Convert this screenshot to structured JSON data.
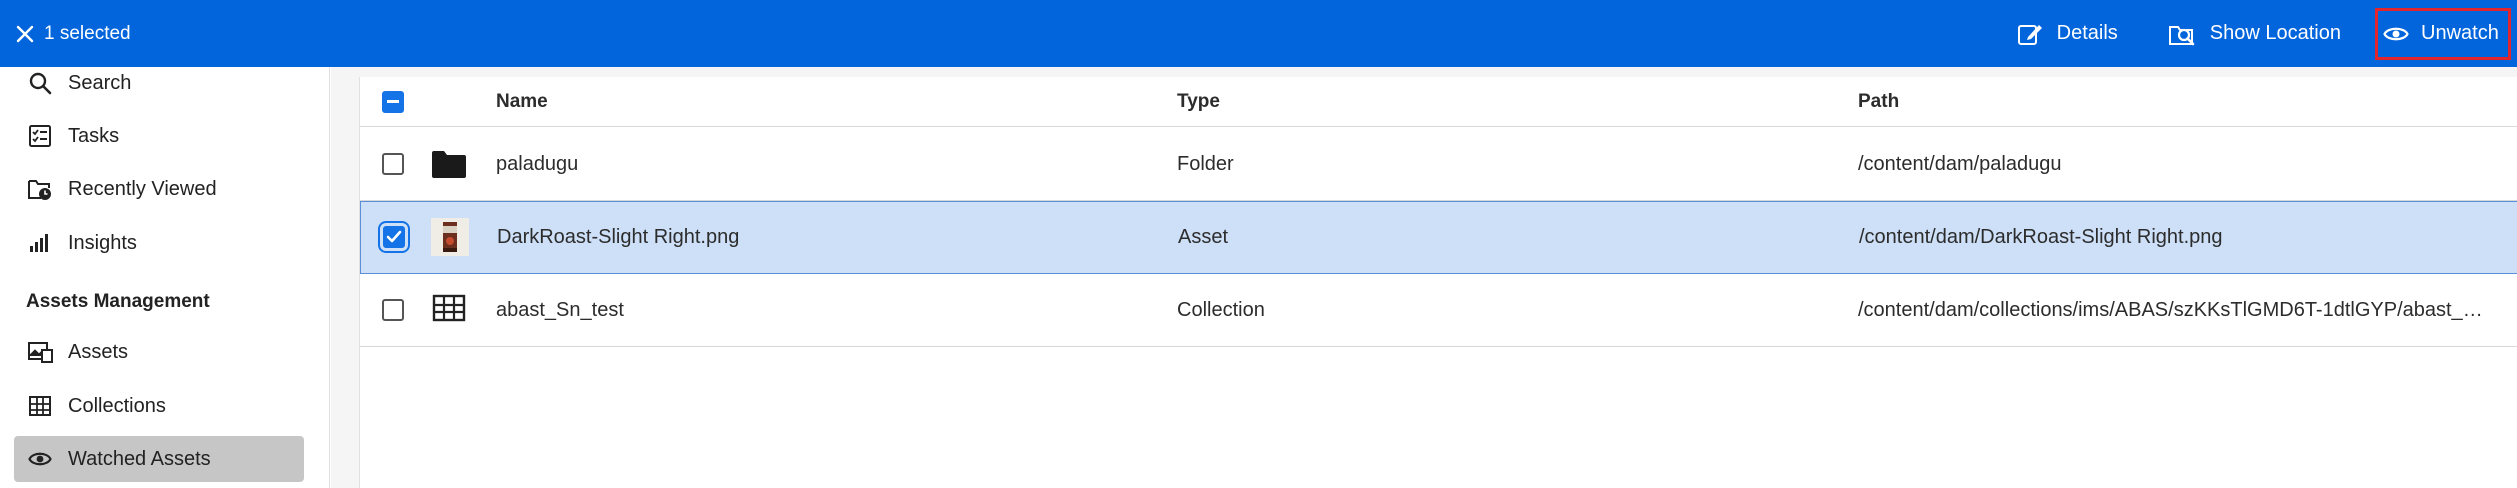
{
  "topbar": {
    "selected_label": "1 selected",
    "actions": {
      "details": "Details",
      "show_location": "Show Location",
      "unwatch": "Unwatch"
    },
    "background": "#0265dc"
  },
  "sidebar": {
    "items": [
      {
        "label": "Search",
        "icon": "search-icon"
      },
      {
        "label": "Tasks",
        "icon": "tasks-icon"
      },
      {
        "label": "Recently Viewed",
        "icon": "recently-viewed-icon"
      },
      {
        "label": "Insights",
        "icon": "insights-icon"
      }
    ],
    "section_title": "Assets Management",
    "section_items": [
      {
        "label": "Assets",
        "icon": "assets-icon"
      },
      {
        "label": "Collections",
        "icon": "collections-icon"
      },
      {
        "label": "Watched Assets",
        "icon": "eye-icon",
        "active": true
      }
    ]
  },
  "table": {
    "columns": {
      "name": "Name",
      "type": "Type",
      "path": "Path"
    },
    "rows": [
      {
        "name": "paladugu",
        "type": "Folder",
        "path": "/content/dam/paladugu",
        "icon": "folder-icon",
        "selected": false
      },
      {
        "name": "DarkRoast-Slight Right.png",
        "type": "Asset",
        "path": "/content/dam/DarkRoast-Slight Right.png",
        "icon": "image-thumbnail",
        "selected": true
      },
      {
        "name": "abast_Sn_test",
        "type": "Collection",
        "path": "/content/dam/collections/ims/ABAS/szKKsTlGMD6T-1dtlGYP/abast_Sn_...",
        "icon": "collection-grid-icon",
        "selected": false
      }
    ]
  }
}
